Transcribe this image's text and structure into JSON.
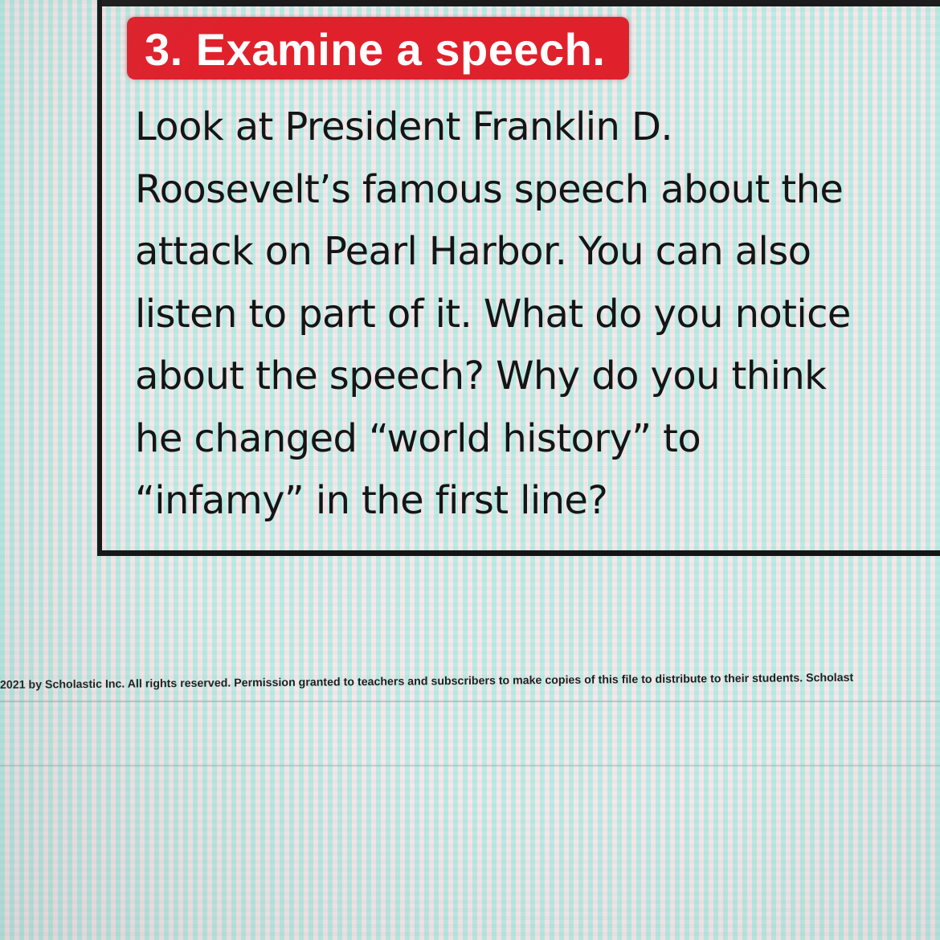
{
  "heading": "3. Examine a speech.",
  "body_lines": [
    "Look at President Franklin D.",
    "Roosevelt’s famous speech about the",
    "attack on Pearl Harbor. You can also",
    "listen to part of it. What do you notice",
    "about the speech? Why do you think",
    "he changed “world history” to",
    "“infamy” in the first line?"
  ],
  "footer": "2021 by Scholastic Inc. All rights reserved. Permission granted to teachers and subscribers to make copies of this file to distribute to their students. Scholast",
  "colors": {
    "heading_background": "#e0212c",
    "heading_text": "#ffffff",
    "body_text": "#151515",
    "border": "#141414"
  }
}
